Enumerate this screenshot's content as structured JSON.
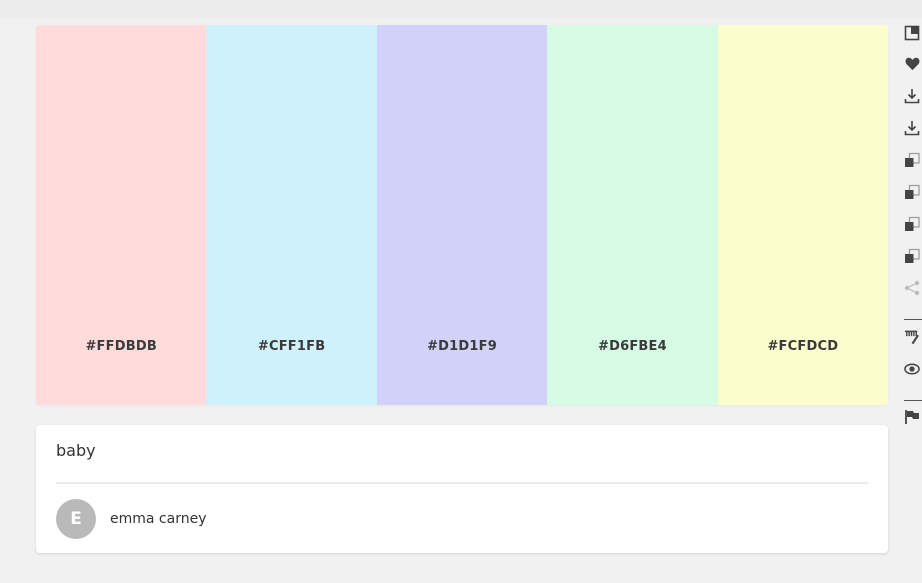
{
  "palette": {
    "colors": [
      {
        "hex_label": "#FFDBDB",
        "color": "#FFDBDB"
      },
      {
        "hex_label": "#CFF1FB",
        "color": "#CFF1FB"
      },
      {
        "hex_label": "#D1D1F9",
        "color": "#D1D1F9"
      },
      {
        "hex_label": "#D6FBE4",
        "color": "#D6FBE4"
      },
      {
        "hex_label": "#FCFDCD",
        "color": "#FCFDCD"
      }
    ]
  },
  "sidebar": {
    "icons": [
      "open-new-icon",
      "heart-icon",
      "download-icon",
      "download-icon",
      "copy-icon",
      "copy-icon",
      "copy-icon",
      "copy-icon",
      "share-icon",
      "palette-tool-icon",
      "eye-icon",
      "flag-icon"
    ]
  },
  "card": {
    "title": "baby",
    "author": {
      "initial": "E",
      "name": "emma carney"
    }
  }
}
